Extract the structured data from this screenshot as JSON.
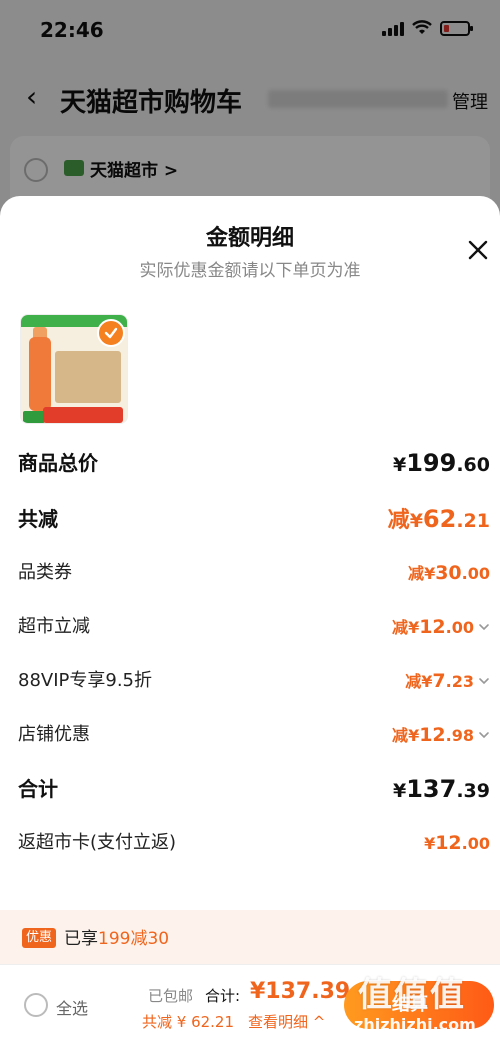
{
  "status_bar": {
    "time": "22:46"
  },
  "nav": {
    "title": "天猫超市购物车",
    "manage_label": "管理"
  },
  "store": {
    "name": "天猫超市 >"
  },
  "sheet": {
    "title": "金额明细",
    "subtitle": "实际优惠金额请以下单页为准",
    "rows": [
      {
        "label": "商品总价",
        "prefix": "",
        "currency": "¥",
        "int": "199",
        "dec": ".60",
        "has_chevron": false
      },
      {
        "label": "共减",
        "prefix": "减",
        "currency": "¥",
        "int": "62",
        "dec": ".21",
        "has_chevron": false
      },
      {
        "label": "品类券",
        "prefix": "减",
        "currency": "¥",
        "int": "30",
        "dec": ".00",
        "has_chevron": false
      },
      {
        "label": "超市立减",
        "prefix": "减",
        "currency": "¥",
        "int": "12",
        "dec": ".00",
        "has_chevron": true
      },
      {
        "label": "88VIP专享9.5折",
        "prefix": "减",
        "currency": "¥",
        "int": "7",
        "dec": ".23",
        "has_chevron": true
      },
      {
        "label": "店铺优惠",
        "prefix": "减",
        "currency": "¥",
        "int": "12",
        "dec": ".98",
        "has_chevron": true
      },
      {
        "label": "合计",
        "prefix": "",
        "currency": "¥",
        "int": "137",
        "dec": ".39",
        "has_chevron": false
      },
      {
        "label": "返超市卡(支付立返)",
        "prefix": "",
        "currency": "¥",
        "int": "12",
        "dec": ".00",
        "has_chevron": false
      }
    ]
  },
  "promo": {
    "badge": "优惠",
    "text_prefix": "已享",
    "text_highlight": "199减30"
  },
  "bottom_bar": {
    "select_all": "全选",
    "shipping": "已包邮",
    "total_label": "合计:",
    "total_value": "¥137.39",
    "saved": "共减 ¥ 62.21",
    "detail_link": "查看明细 ^",
    "checkout": "结算"
  },
  "watermark": {
    "glyphs": "值值值",
    "url": "zhizhizhi.com"
  },
  "colors": {
    "accent": "#f0651d",
    "overlay": "rgba(0,0,0,0.42)"
  }
}
